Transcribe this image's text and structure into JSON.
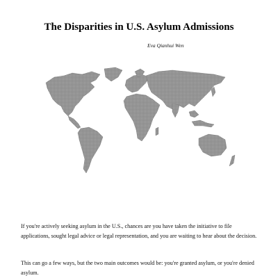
{
  "article": {
    "title": "The Disparities in U.S. Asylum Admissions",
    "author": "Eva Qianhui Wen",
    "paragraphs": [
      "If you're actively seeking asylum in the U.S., chances are you have taken the initiative to file applications, sought legal advice or legal representation, and you are waiting to hear about the decision.",
      "This can go a few ways, but the two main outcomes would be: you're granted asylum, or you're denied asylum."
    ]
  },
  "map": {
    "icon": "world-map-icon",
    "fill_color": "#8a8a8a",
    "pattern_color": "#ffffff"
  }
}
